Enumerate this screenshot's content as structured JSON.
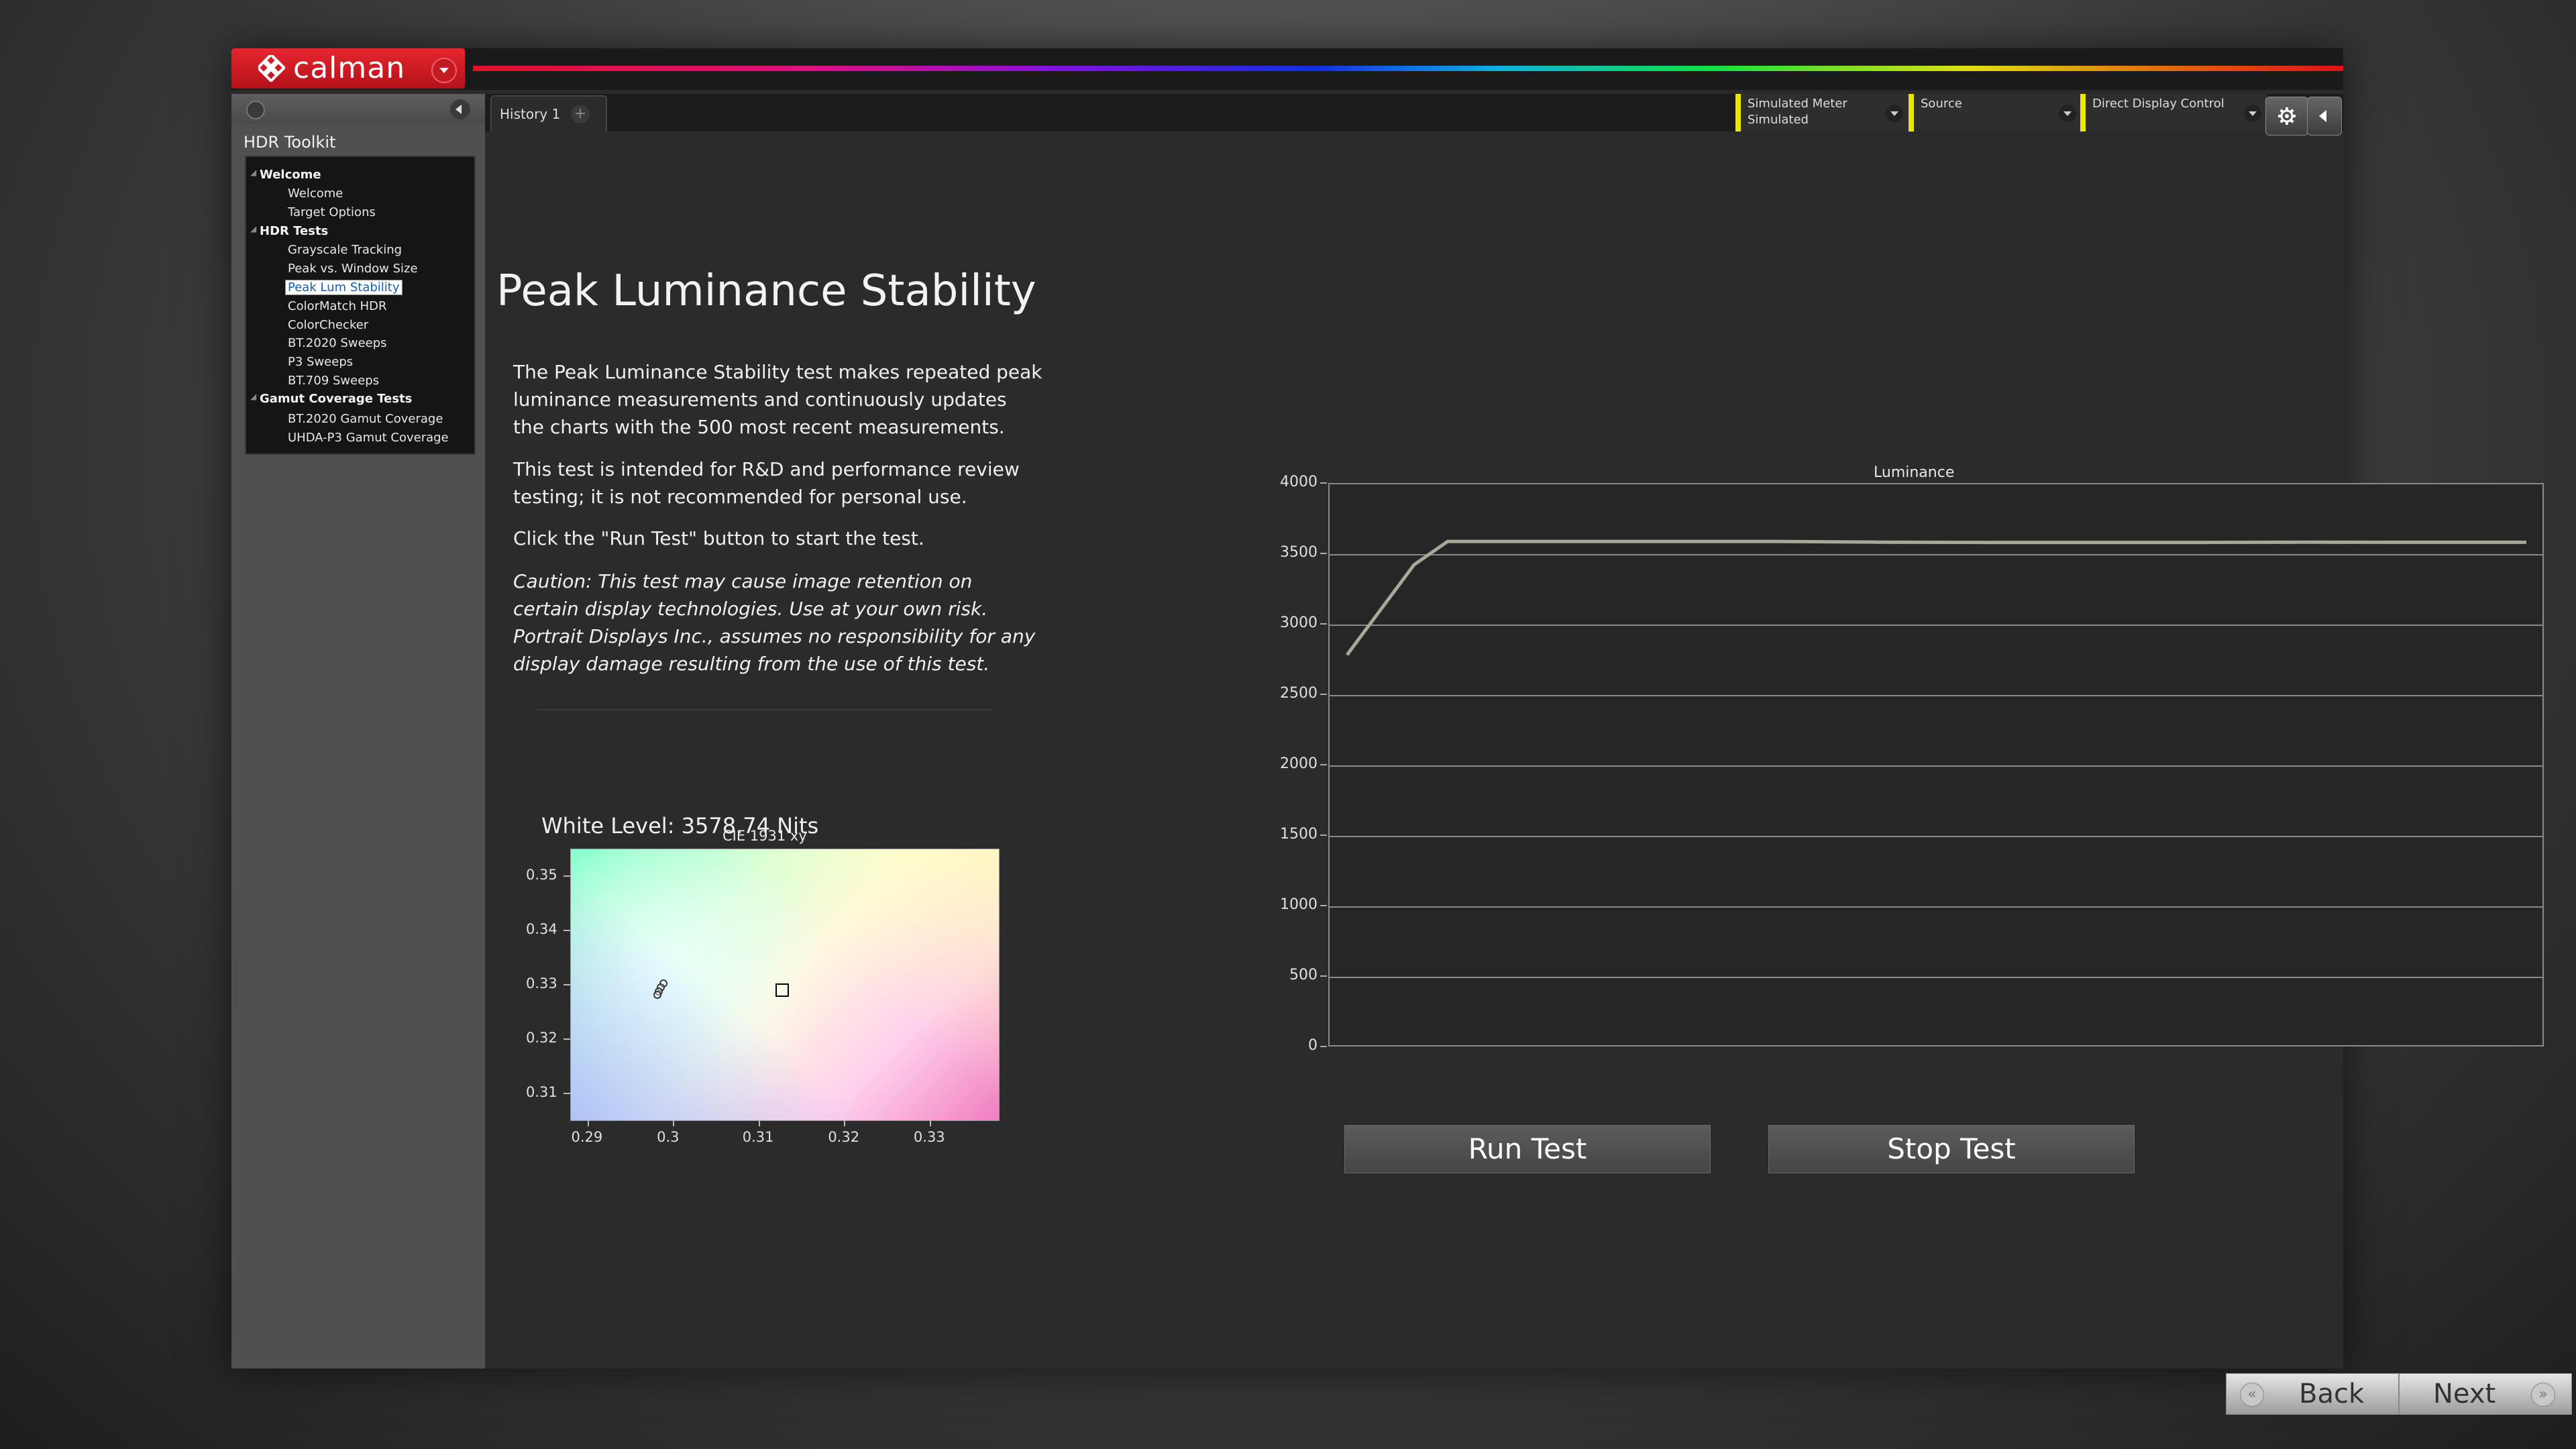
{
  "app": {
    "logo_text": "calman",
    "colors": {
      "brand_red": "#d41e27",
      "accent_yellow": "#e8e800",
      "background": "#2b2b2b"
    }
  },
  "sidebar": {
    "title": "HDR Toolkit",
    "groups": [
      {
        "label": "Welcome",
        "items": [
          "Welcome",
          "Target Options"
        ]
      },
      {
        "label": "HDR Tests",
        "items": [
          "Grayscale Tracking",
          "Peak vs. Window Size",
          "Peak Lum Stability",
          "ColorMatch HDR",
          "ColorChecker",
          "BT.2020 Sweeps",
          "P3 Sweeps",
          "BT.709 Sweeps"
        ]
      },
      {
        "label": "Gamut Coverage Tests",
        "items": [
          "BT.2020 Gamut Coverage",
          "UHDA-P3 Gamut Coverage"
        ]
      }
    ],
    "selected_item": "Peak Lum Stability"
  },
  "tabs": {
    "history_label": "History 1",
    "add_label": "+"
  },
  "devices": {
    "meter": {
      "line1": "Simulated Meter",
      "line2": "Simulated"
    },
    "source": {
      "line1": "Source"
    },
    "display": {
      "line1": "Direct Display Control"
    }
  },
  "main": {
    "title": "Peak Luminance Stability",
    "paragraphs": [
      "The Peak Luminance Stability test makes repeated peak luminance measurements and continuously updates the charts with the 500 most recent measurements.",
      "This test is intended for R&D and performance review testing; it is not recommended for personal use.",
      "Click the \"Run Test\" button to start the test.",
      "Caution: This test may cause image retention on certain display technologies. Use at your own risk. Portrait Displays Inc., assumes no responsibility for any display damage resulting from the use of this test."
    ],
    "white_level": "White Level: 3578.74 Nits",
    "run_button": "Run Test",
    "stop_button": "Stop Test"
  },
  "nav": {
    "back": "Back",
    "next": "Next"
  },
  "chart_data": [
    {
      "type": "line",
      "title": "Luminance",
      "xlabel": "",
      "ylabel": "",
      "ylim": [
        0,
        4000
      ],
      "yticks": [
        "0",
        "500",
        "1000",
        "1500",
        "2000",
        "2500",
        "3000",
        "3500",
        "4000"
      ],
      "x": [
        0,
        1,
        2,
        3,
        4,
        5,
        6,
        7,
        8,
        9,
        10,
        11,
        12
      ],
      "series": [
        {
          "values": [
            2780,
            3420,
            3585,
            3585,
            3585,
            3585,
            3580,
            3578,
            3578,
            3578,
            3580,
            3579,
            3579
          ],
          "color": "#a8a898"
        }
      ],
      "grid": true
    },
    {
      "type": "scatter",
      "title": "CIE 1931 xy",
      "xlim": [
        0.288,
        0.338
      ],
      "ylim": [
        0.305,
        0.355
      ],
      "xticks": [
        "0.29",
        "0.3",
        "0.31",
        "0.32",
        "0.33"
      ],
      "yticks": [
        "0.31",
        "0.32",
        "0.33",
        "0.34",
        "0.35"
      ],
      "target": {
        "x": 0.3127,
        "y": 0.329
      },
      "measurements": [
        {
          "x": 0.2988,
          "y": 0.3302
        },
        {
          "x": 0.2985,
          "y": 0.3295
        },
        {
          "x": 0.2983,
          "y": 0.3288
        },
        {
          "x": 0.2981,
          "y": 0.3281
        }
      ]
    }
  ]
}
